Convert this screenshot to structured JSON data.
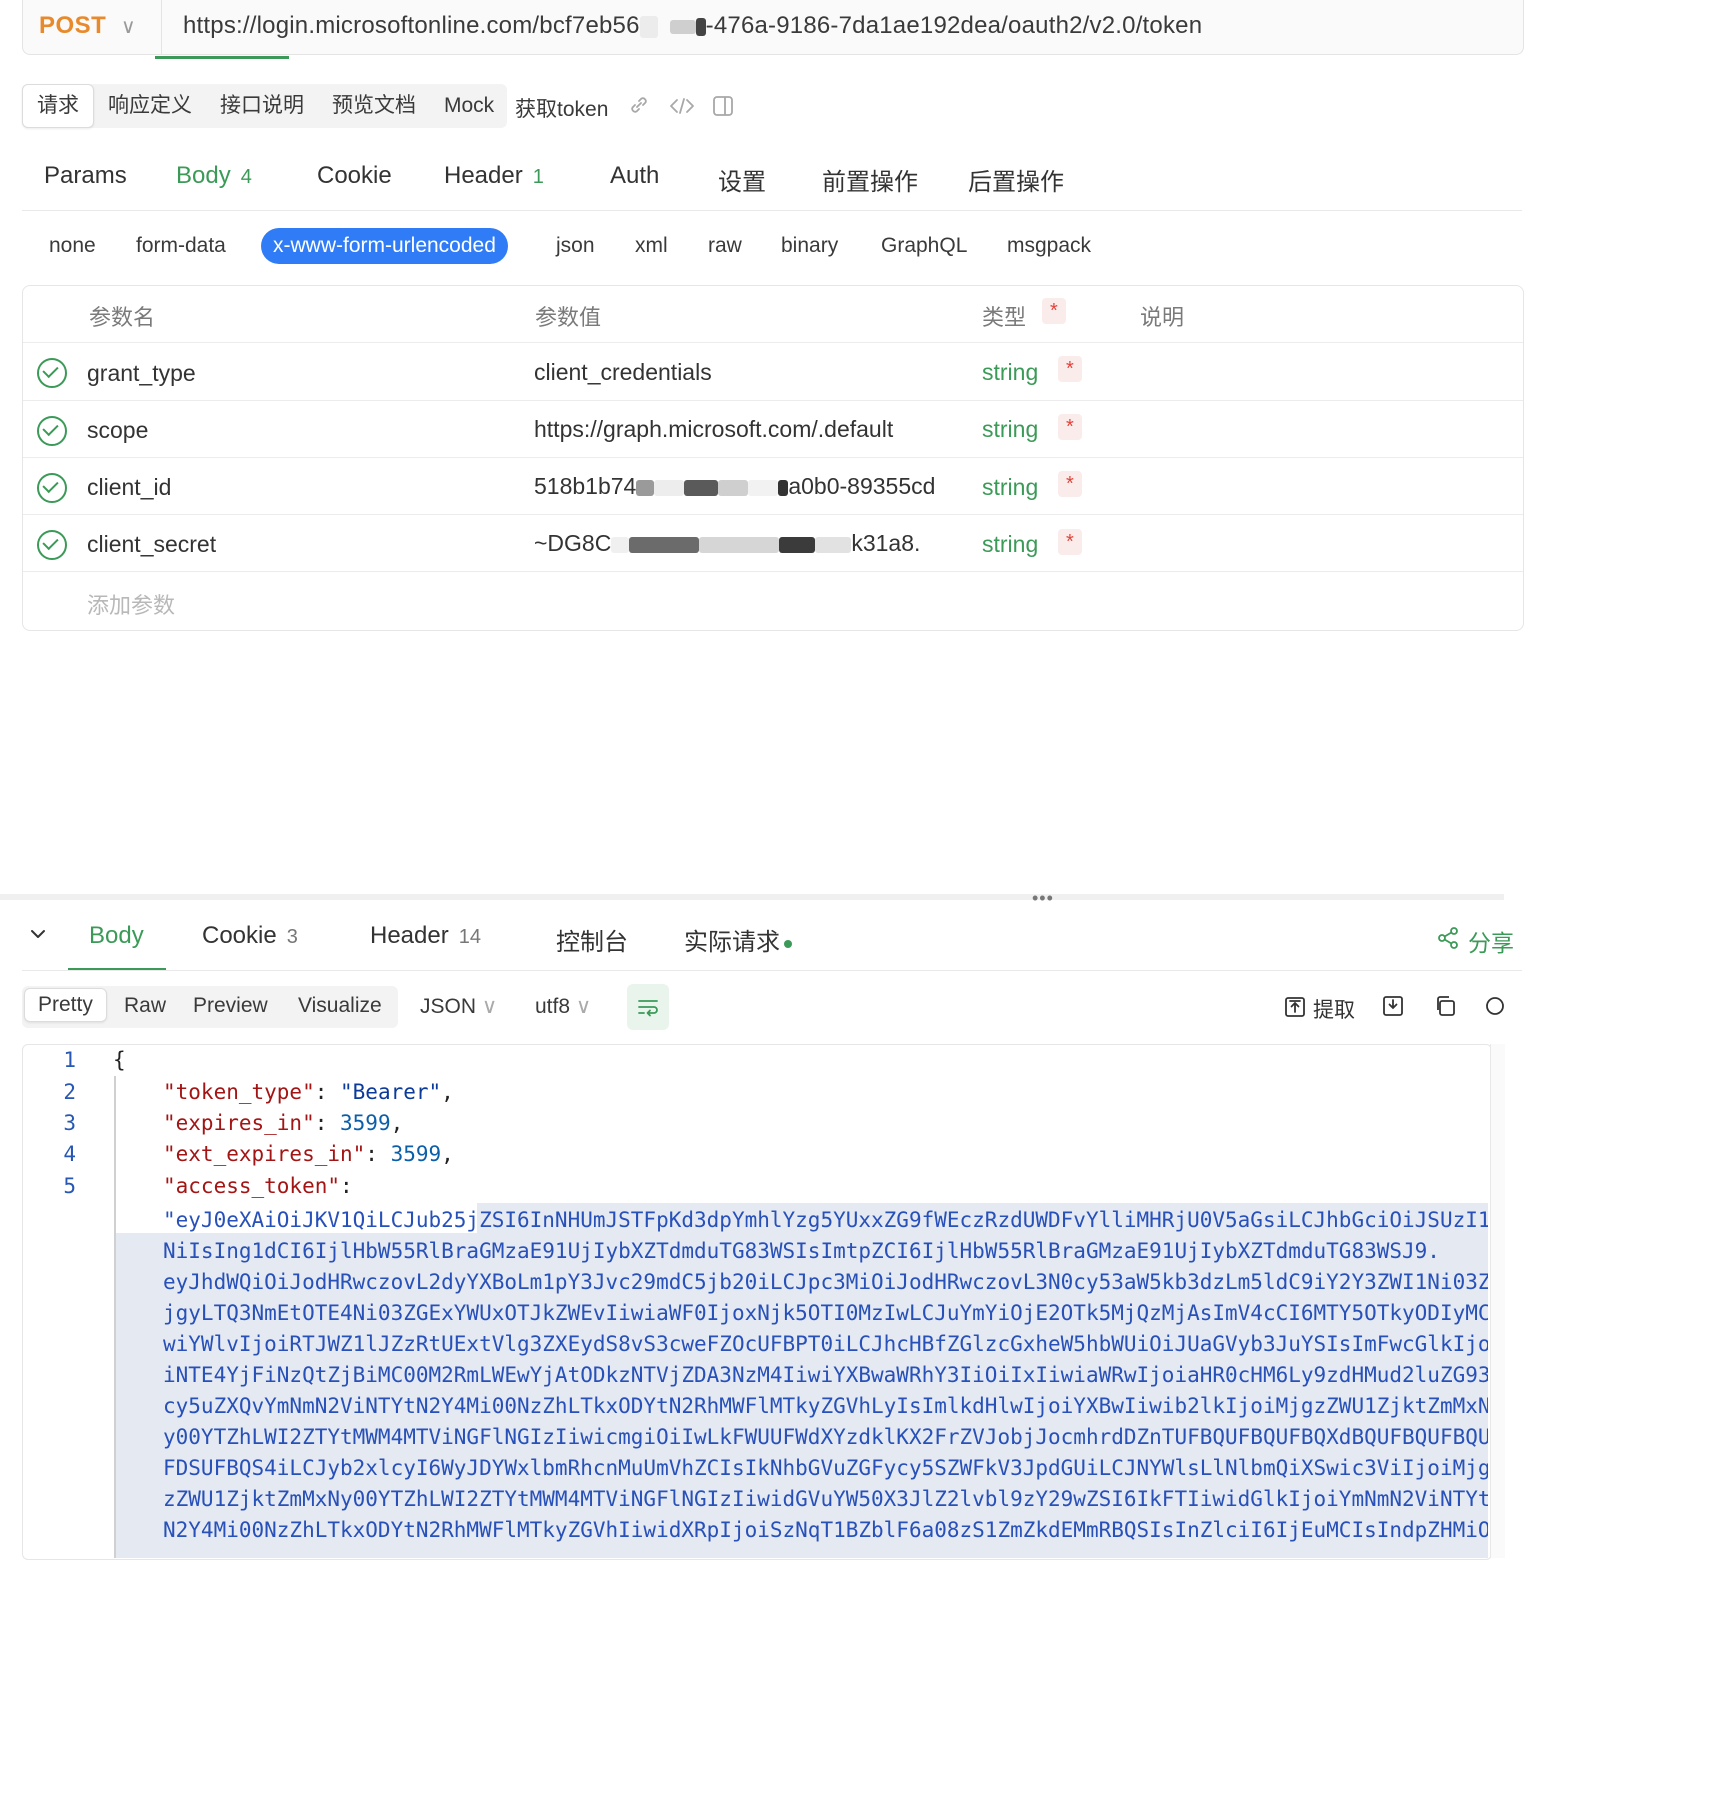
{
  "url_bar": {
    "method": "POST",
    "url_prefix": "https://login.microsoftonline.com/bcf7eb56",
    "url_suffix": "-476a-9186-7da1ae192dea/oauth2/v2.0/token"
  },
  "top_tabs": [
    "请求",
    "响应定义",
    "接口说明",
    "预览文档",
    "Mock"
  ],
  "top_extra": "获取token",
  "request_tabs": [
    {
      "label": "Params"
    },
    {
      "label": "Body",
      "count": "4"
    },
    {
      "label": "Cookie"
    },
    {
      "label": "Header",
      "count": "1"
    },
    {
      "label": "Auth"
    },
    {
      "label": "设置"
    },
    {
      "label": "前置操作"
    },
    {
      "label": "后置操作"
    }
  ],
  "body_types": [
    "none",
    "form-data",
    "x-www-form-urlencoded",
    "json",
    "xml",
    "raw",
    "binary",
    "GraphQL",
    "msgpack"
  ],
  "params_table": {
    "headers": {
      "name": "参数名",
      "value": "参数值",
      "type": "类型",
      "desc": "说明"
    },
    "required_mark": "*",
    "rows": [
      {
        "name": "grant_type",
        "value": "client_credentials",
        "type": "string"
      },
      {
        "name": "scope",
        "value": "https://graph.microsoft.com/.default",
        "type": "string"
      },
      {
        "name": "client_id",
        "value_prefix": "518b1b74",
        "value_suffix": "a0b0-89355cd",
        "type": "string"
      },
      {
        "name": "client_secret",
        "value_prefix": "~DG8C",
        "value_suffix": "k31a8.",
        "type": "string"
      }
    ],
    "add_placeholder": "添加参数"
  },
  "response_tabs": [
    {
      "label": "Body"
    },
    {
      "label": "Cookie",
      "count": "3"
    },
    {
      "label": "Header",
      "count": "14"
    },
    {
      "label": "控制台"
    },
    {
      "label": "实际请求"
    }
  ],
  "share_label": "分享",
  "format_tabs": [
    "Pretty",
    "Raw",
    "Preview",
    "Visualize"
  ],
  "format_select": "JSON",
  "encoding_select": "utf8",
  "extract_label": "提取",
  "code": {
    "line_numbers": [
      "1",
      "2",
      "3",
      "4",
      "5"
    ],
    "open_brace": "{",
    "token_type_key": "\"token_type\"",
    "token_type_val": "\"Bearer\"",
    "expires_in_key": "\"expires_in\"",
    "expires_in_val": "3599",
    "ext_expires_in_key": "\"ext_expires_in\"",
    "ext_expires_in_val": "3599",
    "access_token_key": "\"access_token\"",
    "token_lines": [
      "\"eyJ0eXAiOiJKV1QiLCJub25jZSI6InNHUmJSTFpKd3dpYmhlYzg5YUxxZG9fWEczRzdUWDFvYlliMHRjU0V5aGsiLCJhbGciOiJSUzI1",
      "NiIsIng1dCI6IjlHbW55RlBraGMzaE91UjIybXZTdmduTG83WSIsImtpZCI6IjlHbW55RlBraGMzaE91UjIybXZTdmduTG83WSJ9.",
      "eyJhdWQiOiJodHRwczovL2dyYXBoLm1pY3Jvc29mdC5jb20iLCJpc3MiOiJodHRwczovL3N0cy53aW5kb3dzLm5ldC9iY2Y3ZWI1Ni03Z",
      "jgyLTQ3NmEtOTE4Ni03ZGExYWUxOTJkZWEvIiwiaWF0IjoxNjk5OTI0MzIwLCJuYmYiOjE2OTk5MjQzMjAsImV4cCI6MTY5OTkyODIyMC",
      "wiYWlvIjoiRTJWZ1lJZzRtUExtVlg3ZXEydS8vS3cweFZOcUFBPT0iLCJhcHBfZGlzcGxheW5hbWUiOiJUaGVyb3JuYSIsImFwcGlkIjo",
      "iNTE4YjFiNzQtZjBiMC00M2RmLWEwYjAtODkzNTVjZDA3NzM4IiwiYXBwaWRhY3IiOiIxIiwiaWRwIjoiaHR0cHM6Ly9zdHMud2luZG93",
      "cy5uZXQvYmNmN2ViNTYtN2Y4Mi00NzZhLTkxODYtN2RhMWFlMTkyZGVhLyIsImlkdHlwIjoiYXBwIiwib2lkIjoiMjgzZWU1ZjktZmMxN",
      "y00YTZhLWI2ZTYtMWM4MTViNGFlNGIzIiwicmgiOiIwLkFWUUFWdXYzdklKX2FrZVJobjJocmhrdDZnTUFBQUFBQUFBQXdBQUFBQUFBQU",
      "FDSUFBQS4iLCJyb2xlcyI6WyJDYWxlbmRhcnMuUmVhZCIsIkNhbGVuZGFycy5SZWFkV3JpdGUiLCJNYWlsLlNlbmQiXSwic3ViIjoiMjg",
      "zZWU1ZjktZmMxNy00YTZhLWI2ZTYtMWM4MTViNGFlNGIzIiwidGVuYW50X3JlZ2lvbl9zY29wZSI6IkFTIiwidGlkIjoiYmNmN2ViNTYt",
      "N2Y4Mi00NzZhLTkxODYtN2RhMWFlMTkyZGVhIiwidXRpIjoiSzNqT1BZblF6a08zS1ZmZkdEMmRBQSIsInZlciI6IjEuMCIsIndpZHMiO"
    ]
  },
  "colors": {
    "accent_green": "#3b9a57",
    "method_orange": "#e8892b",
    "pill_blue": "#2f7cf6",
    "required_red": "#e0443b"
  }
}
